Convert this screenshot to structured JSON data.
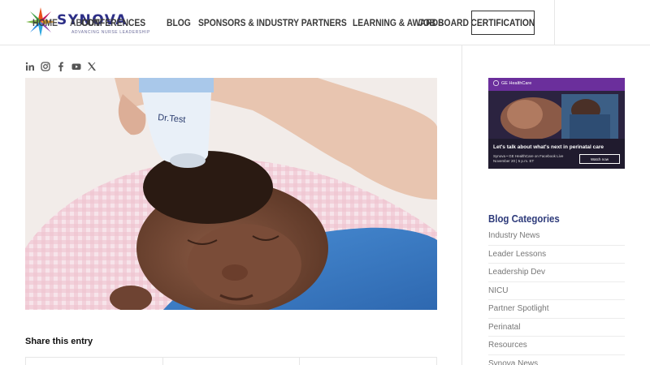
{
  "brand": {
    "name": "SYNOVA",
    "tagline": "ADVANCING NURSE LEADERSHIP"
  },
  "nav": {
    "items": [
      {
        "label": "HOME"
      },
      {
        "label": "ABOUT"
      },
      {
        "label": "CONFERENCES"
      },
      {
        "label": "BLOG"
      },
      {
        "label": "SPONSORS & INDUSTRY PARTNERS"
      },
      {
        "label": "LEARNING & AWARDS"
      },
      {
        "label": "JOB BOARD"
      }
    ],
    "cta": "CERTIFICATION"
  },
  "social": [
    "linkedin-icon",
    "instagram-icon",
    "facebook-icon",
    "youtube-icon",
    "x-icon"
  ],
  "share": {
    "title": "Share this entry"
  },
  "ad": {
    "brand": "GE HealthCare",
    "headline": "Let's talk about what's next in perinatal care",
    "line1": "Synova • GE HealthCare on Facebook Live",
    "line2": "November 20 | 5 p.m. ET",
    "button": "Watch now"
  },
  "categories": {
    "title": "Blog Categories",
    "items": [
      {
        "label": "Industry News"
      },
      {
        "label": "Leader Lessons"
      },
      {
        "label": "Leadership Dev"
      },
      {
        "label": "NICU"
      },
      {
        "label": "Partner Spotlight"
      },
      {
        "label": "Perinatal"
      },
      {
        "label": "Resources"
      },
      {
        "label": "Synova News"
      }
    ]
  },
  "colors": {
    "brand": "#2d2f87",
    "category_heading": "#2d3a7a",
    "ad_bar": "#6b2f9c"
  }
}
